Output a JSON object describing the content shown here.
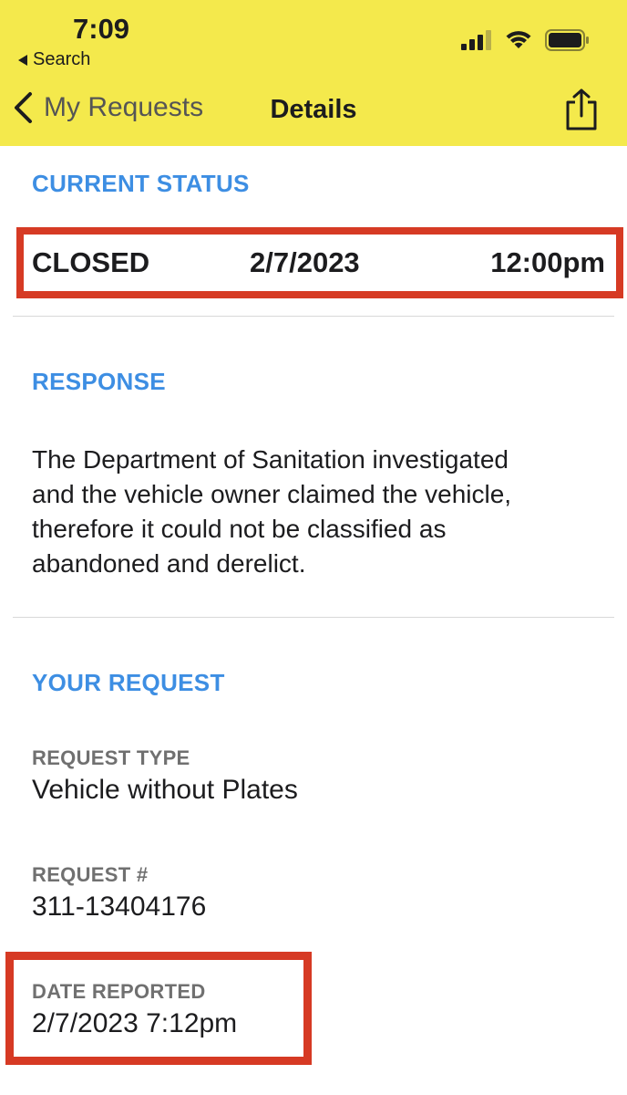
{
  "status_bar": {
    "time": "7:09",
    "back_app": "Search"
  },
  "nav": {
    "back_label": "My Requests",
    "title": "Details"
  },
  "current_status": {
    "heading": "CURRENT STATUS",
    "state": "CLOSED",
    "date": "2/7/2023",
    "time": "12:00pm"
  },
  "response": {
    "heading": "RESPONSE",
    "lines": [
      "The Department of Sanitation investigated",
      "and the vehicle owner claimed the vehicle,",
      "therefore it could not be classified as",
      "abandoned and derelict."
    ]
  },
  "your_request": {
    "heading": "YOUR REQUEST",
    "type_label": "REQUEST TYPE",
    "type_value": "Vehicle without Plates",
    "number_label": "REQUEST #",
    "number_value": "311-13404176",
    "date_label": "DATE REPORTED",
    "date_value": "2/7/2023 7:12pm"
  },
  "colors": {
    "header_bg": "#f4e94c",
    "section_heading": "#3d8ee3",
    "highlight_border": "#d63a24",
    "field_label": "#707070"
  },
  "icons": [
    "signal-icon",
    "wifi-icon",
    "battery-icon",
    "chevron-left-icon",
    "share-icon"
  ]
}
